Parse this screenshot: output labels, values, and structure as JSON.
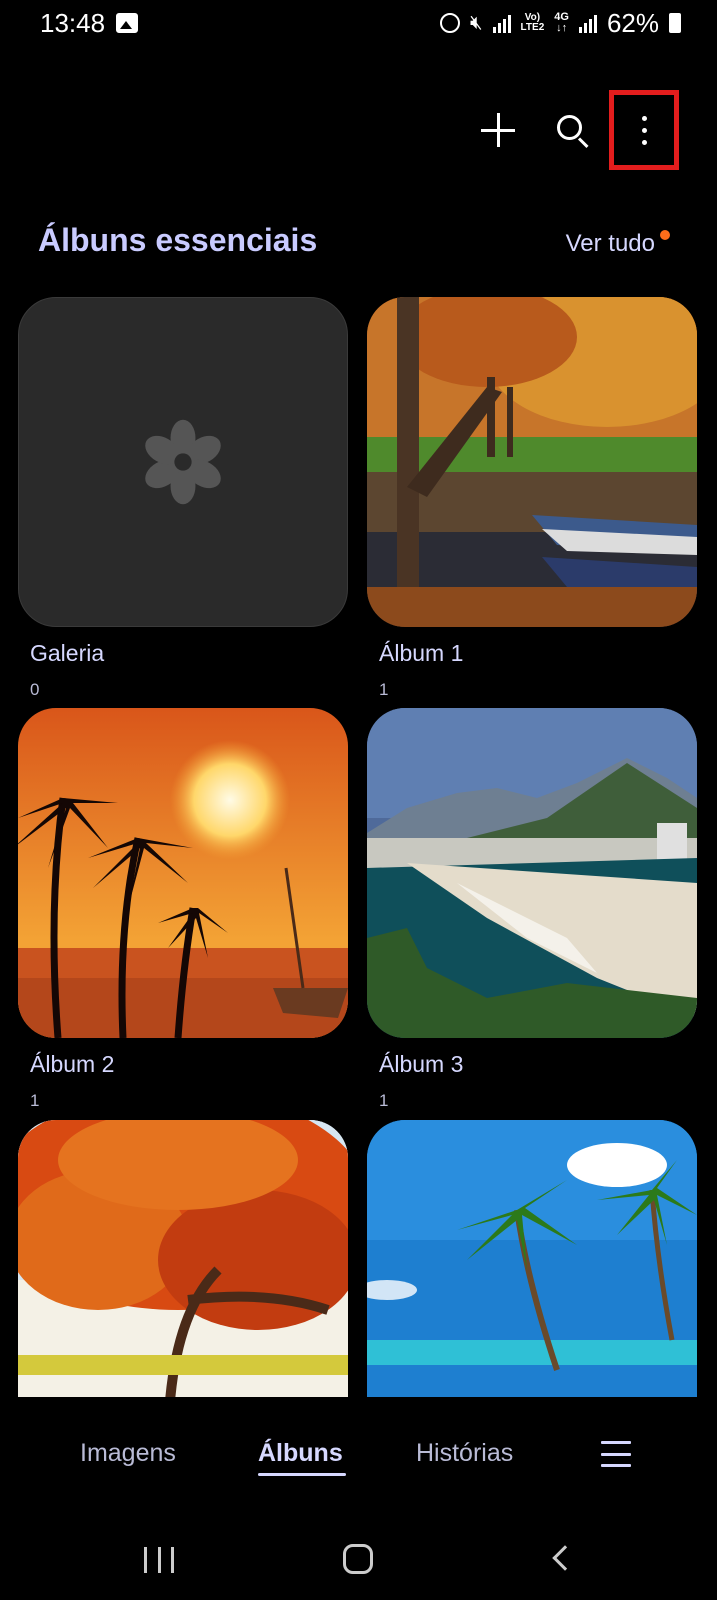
{
  "status_bar": {
    "time": "13:48",
    "lte_label_top": "Vo)",
    "lte_label_bottom": "LTE2",
    "network_label": "4G",
    "battery": "62%"
  },
  "header": {
    "section_title": "Álbuns essenciais",
    "see_all_label": "Ver tudo",
    "accent_color": "#c9cbff",
    "notification_dot_color": "#ff6d1a"
  },
  "albums": [
    {
      "name": "Galeria",
      "count": "0"
    },
    {
      "name": "Álbum 1",
      "count": "1"
    },
    {
      "name": "Álbum 2",
      "count": "1"
    },
    {
      "name": "Álbum 3",
      "count": "1"
    },
    {
      "name": "",
      "count": ""
    },
    {
      "name": "",
      "count": ""
    }
  ],
  "bottom_nav": {
    "items": [
      {
        "label": "Imagens"
      },
      {
        "label": "Álbuns"
      },
      {
        "label": "Histórias"
      }
    ],
    "active": "Álbuns"
  },
  "icons": {
    "add": "plus-icon",
    "search": "search-icon",
    "more": "more-vertical-icon",
    "menu": "hamburger-menu-icon",
    "gallery_placeholder": "flower-icon",
    "highlight_color": "#e31d1d"
  }
}
